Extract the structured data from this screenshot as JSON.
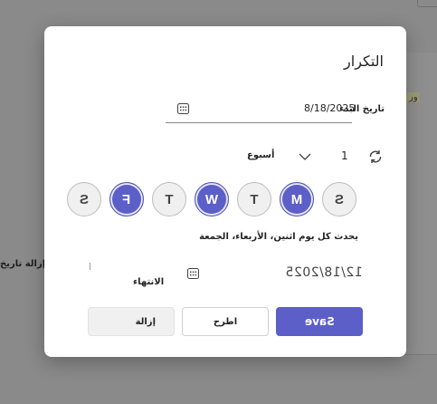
{
  "background": {
    "tag_text": "ور",
    "side_label": "إزالة تاريخ"
  },
  "dialog": {
    "title": "التكرار",
    "start_date_label": "تاريخ البدء",
    "start_date_value": "8/18/2025",
    "repeat_interval": "1",
    "repeat_unit": "أسبوع",
    "days": [
      {
        "letter": "S",
        "selected": false
      },
      {
        "letter": "M",
        "selected": true
      },
      {
        "letter": "T",
        "selected": false
      },
      {
        "letter": "W",
        "selected": true
      },
      {
        "letter": "T",
        "selected": false
      },
      {
        "letter": "F",
        "selected": true
      },
      {
        "letter": "S",
        "selected": false
      }
    ],
    "summary": "يحدث كل يوم اثنين، الأربعاء، الجمعة",
    "end_date_value": "12/18/2025",
    "end_date_label": "الانتهاء",
    "buttons": {
      "save": "Save",
      "discard": "اطرح",
      "remove": "إزالة"
    },
    "colors": {
      "accent": "#5b5fc7",
      "selected_text": "#ffffff"
    }
  }
}
